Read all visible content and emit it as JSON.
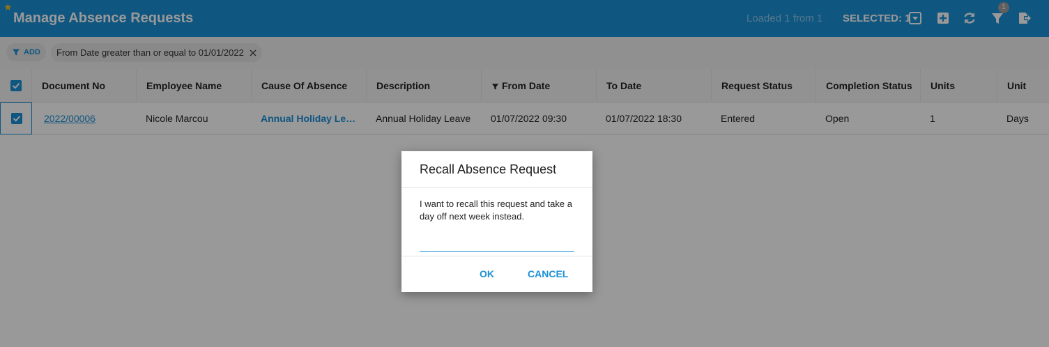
{
  "header": {
    "title": "Manage Absence Requests",
    "loaded_text": "Loaded 1 from 1",
    "selected_text": "SELECTED: 1",
    "filter_badge": "1",
    "background": "#1a8fd6"
  },
  "filterbar": {
    "add_label": "ADD",
    "chips": [
      {
        "label": "From Date greater than or equal to 01/01/2022"
      }
    ]
  },
  "table": {
    "columns": [
      "Document No",
      "Employee Name",
      "Cause Of Absence",
      "Description",
      "From Date",
      "To Date",
      "Request Status",
      "Completion Status",
      "Units",
      "Unit"
    ],
    "rows": [
      {
        "document_no": "2022/00006",
        "employee_name": "Nicole Marcou",
        "cause_of_absence": "Annual Holiday Leave",
        "description": "Annual Holiday Leave",
        "from_date": "01/07/2022 09:30",
        "to_date": "01/07/2022 18:30",
        "request_status": "Entered",
        "completion_status": "Open",
        "units": "1",
        "unit": "Days"
      }
    ]
  },
  "dialog": {
    "title": "Recall Absence Request",
    "message": "I want to recall this request and take a day off next week instead.",
    "input_value": "",
    "ok_label": "OK",
    "cancel_label": "CANCEL"
  },
  "icons": {
    "favorite": "star-icon",
    "selection_menu": "dropdown-box-icon",
    "add": "plus-box-icon",
    "refresh": "refresh-icon",
    "filter": "filter-icon",
    "export": "export-icon"
  },
  "colors": {
    "accent": "#1a8fd6",
    "star": "#f3c12a"
  }
}
